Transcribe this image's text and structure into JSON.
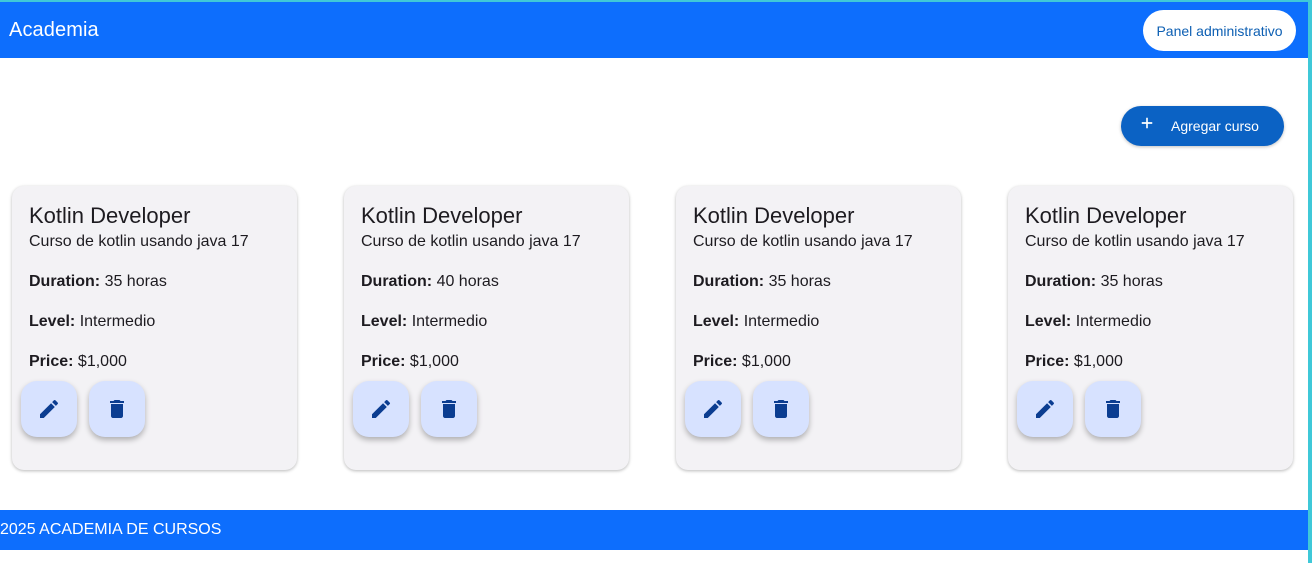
{
  "header": {
    "title": "Academia",
    "admin_button": "Panel administrativo"
  },
  "toolbar": {
    "add_icon": "plus-icon",
    "add_label": "Agregar curso"
  },
  "labels": {
    "duration": "Duration:",
    "level": "Level:",
    "price": "Price:"
  },
  "courses": [
    {
      "title": "Kotlin Developer",
      "description": "Curso de kotlin usando java 17",
      "duration": "35 horas",
      "level": "Intermedio",
      "price": "$1,000"
    },
    {
      "title": "Kotlin Developer",
      "description": "Curso de kotlin usando java 17",
      "duration": "40 horas",
      "level": "Intermedio",
      "price": "$1,000"
    },
    {
      "title": "Kotlin Developer",
      "description": "Curso de kotlin usando java 17",
      "duration": "35 horas",
      "level": "Intermedio",
      "price": "$1,000"
    },
    {
      "title": "Kotlin Developer",
      "description": "Curso de kotlin usando java 17",
      "duration": "35 horas",
      "level": "Intermedio",
      "price": "$1,000"
    }
  ],
  "card_actions": {
    "edit_icon": "pencil-icon",
    "delete_icon": "trash-icon"
  },
  "footer": {
    "text": "2025 ACADEMIA DE CURSOS"
  },
  "colors": {
    "primary": "#0d6efd",
    "button_dark": "#0b62c4",
    "card_bg": "#f3f2f5",
    "fab_bg": "#d7e2ff",
    "icon": "#0b3d91"
  }
}
